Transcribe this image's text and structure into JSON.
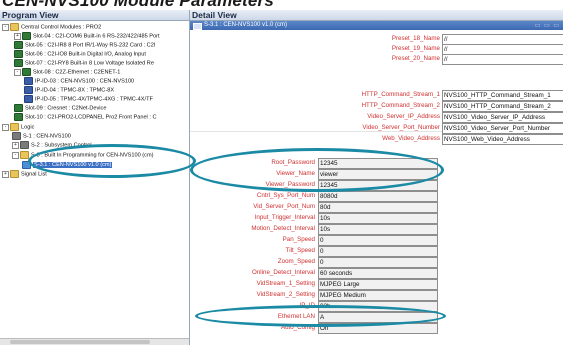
{
  "document": {
    "title": "CEN-NVS100 Module Parameters"
  },
  "left_pane": {
    "title": "Program View",
    "tree": [
      {
        "label": "Central Control Modules : PRO2",
        "icon": "folder-icon",
        "exp": "-"
      },
      {
        "label": "Slot-04 : C2I-COM6 Built-in 6 RS-232/422/485 Port",
        "icon": "card-icon",
        "exp": "+"
      },
      {
        "label": "Slot-05 : C2I-IR8 8 Port IR/1-Way RS-232 Card : C2I",
        "icon": "card-icon",
        "exp": ""
      },
      {
        "label": "Slot-06 : C2I-IO8 Built-in Digital I/O, Analog Input",
        "icon": "card-icon",
        "exp": ""
      },
      {
        "label": "Slot-07 : C2I-RY8 Built-in 8 Low Voltage Isolated Re",
        "icon": "card-icon",
        "exp": ""
      },
      {
        "label": "Slot-08 : C2Z-Ethernet : C2ENET-1",
        "icon": "card-icon",
        "exp": "-"
      },
      {
        "label": "IP-ID-03 : CEN-NVS100 : CEN-NVS100",
        "icon": "device-icon",
        "exp": ""
      },
      {
        "label": "IP-ID-04 : TPMC-8X : TPMC-8X",
        "icon": "device-icon",
        "exp": ""
      },
      {
        "label": "IP-ID-05 : TPMC-4X/TPMC-4XG : TPMC-4X/TF",
        "icon": "device-icon",
        "exp": ""
      },
      {
        "label": "Slot-09 : Cresnet : C2Net-Device",
        "icon": "card-icon",
        "exp": ""
      },
      {
        "label": "Slot-10 : C2I-PRO2-LCDPANEL Pro2 Front Panel : C",
        "icon": "card-icon",
        "exp": ""
      },
      {
        "label": "Logic",
        "icon": "folder-icon",
        "exp": "-"
      },
      {
        "label": "S-1 : CEN-NVS100",
        "icon": "program-icon",
        "exp": ""
      },
      {
        "label": "S-2 : Subsystem Control",
        "icon": "program-icon",
        "exp": "+"
      },
      {
        "label": "S-3 : Built In Programming for CEN-NVS100 (cm)",
        "icon": "folder-icon",
        "exp": "-"
      },
      {
        "label": "S-3.1 : CEN-NVS100 v1.0 (cm)",
        "icon": "symbol-icon",
        "exp": "",
        "selected": true
      },
      {
        "label": "Signal List",
        "icon": "folder-icon",
        "exp": "+"
      }
    ]
  },
  "right_pane": {
    "title": "Detail View",
    "device_bar": "S-3.1 : CEN-NVS100 v1.0 (cm)",
    "window_buttons": "▭ ▭ ▭",
    "upper_props": [
      {
        "name": "Preset_18_Name",
        "value": "//"
      },
      {
        "name": "Preset_19_Name",
        "value": "//"
      },
      {
        "name": "Preset_20_Name",
        "value": "//"
      },
      {
        "name": "HTTP_Command_Stream_1",
        "value": "NVS100_HTTP_Command_Stream_1"
      },
      {
        "name": "HTTP_Command_Stream_2",
        "value": "NVS100_HTTP_Command_Stream_2"
      },
      {
        "name": "Video_Server_IP_Address",
        "value": "NVS100_Video_Server_IP_Address"
      },
      {
        "name": "Video_Server_Port_Number",
        "value": "NVS100_Video_Server_Port_Number"
      },
      {
        "name": "Web_Video_Address",
        "value": "NVS100_Web_Video_Address"
      }
    ],
    "lower_props": [
      {
        "name": "Root_Password",
        "value": "12345"
      },
      {
        "name": "Viewer_Name",
        "value": "viewer"
      },
      {
        "name": "Viewer_Password",
        "value": "12345"
      },
      {
        "name": "Cntrl_Sys_Port_Num",
        "value": "8080d"
      },
      {
        "name": "Vid_Server_Port_Num",
        "value": "80d"
      },
      {
        "name": "Input_Trigger_Interval",
        "value": "10s"
      },
      {
        "name": "Motion_Detect_Interval",
        "value": "10s"
      },
      {
        "name": "Pan_Speed",
        "value": "0"
      },
      {
        "name": "Tilt_Speed",
        "value": "0"
      },
      {
        "name": "Zoom_Speed",
        "value": "0"
      },
      {
        "name": "Online_Detect_Interval",
        "value": "60 seconds"
      },
      {
        "name": "VidStream_1_Setting",
        "value": "MJPEG Large"
      },
      {
        "name": "VidStream_2_Setting",
        "value": "MJPEG Medium"
      },
      {
        "name": "IP_ID",
        "value": "03h"
      },
      {
        "name": "Ethernet LAN",
        "value": "A"
      },
      {
        "name": "Auto_Config",
        "value": "On"
      }
    ]
  },
  "colors": {
    "param_name": "#d03030",
    "highlight_oval": "#1b8aa5",
    "header_blue": "#3b68b0"
  }
}
